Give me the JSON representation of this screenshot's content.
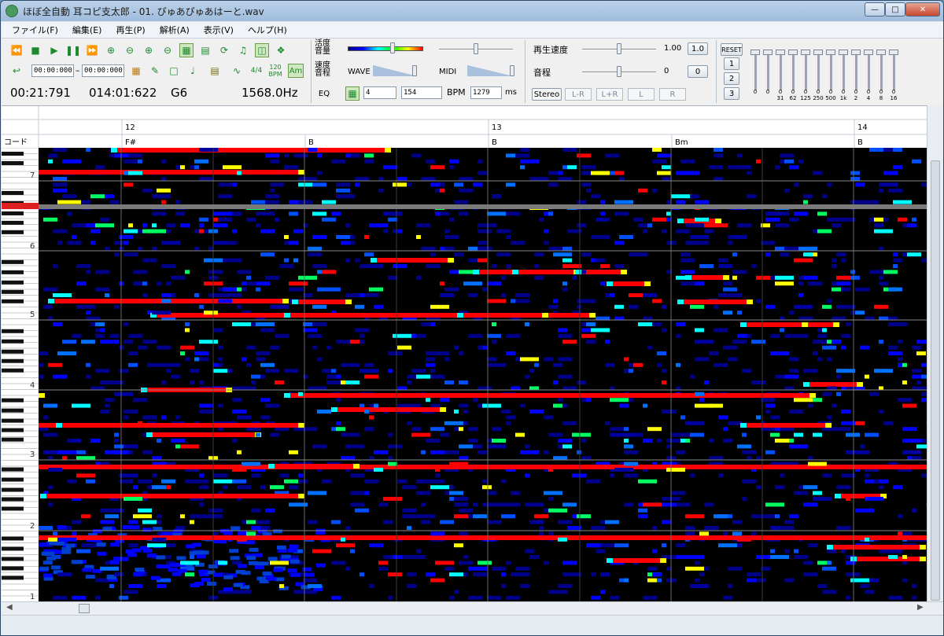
{
  "window": {
    "title": "ほぼ全自動 耳コピ支太郎 - 01. ぴゅあぴゅあはーと.wav"
  },
  "menu": [
    "ファイル(F)",
    "編集(E)",
    "再生(P)",
    "解析(A)",
    "表示(V)",
    "ヘルプ(H)"
  ],
  "toolbar": {
    "time_start": "00:00:000",
    "time_sep": "–",
    "time_end": "00:00:000",
    "meter": "4/4",
    "bpm_icon_num": "120",
    "bpm_icon_text": "BPM",
    "chord_btn": "Am",
    "label_vol1": "活度",
    "label_vol2": "音量",
    "label_spd1": "速度",
    "label_spd2": "音程",
    "wave_label": "WAVE",
    "midi_label": "MIDI",
    "eq_label": "EQ",
    "beats": "4",
    "bpm_value": "154",
    "bpm_label": "BPM",
    "ms_value": "1279",
    "ms_label": "ms",
    "speed_label": "再生速度",
    "speed_value": "1.00",
    "speed_btn": "1.0",
    "pitch_label": "音程",
    "pitch_value": "0",
    "pitch_btn": "0",
    "channels": [
      "Stereo",
      "L-R",
      "L+R",
      "L",
      "R"
    ],
    "reset": "RESET",
    "presets": [
      "1",
      "2",
      "3"
    ],
    "eq_values": [
      "0",
      "0",
      "0",
      "0",
      "0",
      "0",
      "0",
      "0",
      "0",
      "0",
      "0",
      "0"
    ],
    "eq_freqs": [
      "31",
      "62",
      "125",
      "250",
      "500",
      "1k",
      "2",
      "4",
      "8",
      "16"
    ]
  },
  "readout": {
    "time": "00:21:791",
    "position": "014:01:622",
    "note": "G6",
    "freq": "1568.0Hz"
  },
  "ruler": {
    "chord_label": "コード",
    "bars": [
      "12",
      "13",
      "14"
    ],
    "chords": [
      "F#",
      "B",
      "B",
      "Bm",
      "B"
    ]
  },
  "octaves": [
    "7",
    "6",
    "5",
    "4",
    "3",
    "2",
    "1"
  ]
}
